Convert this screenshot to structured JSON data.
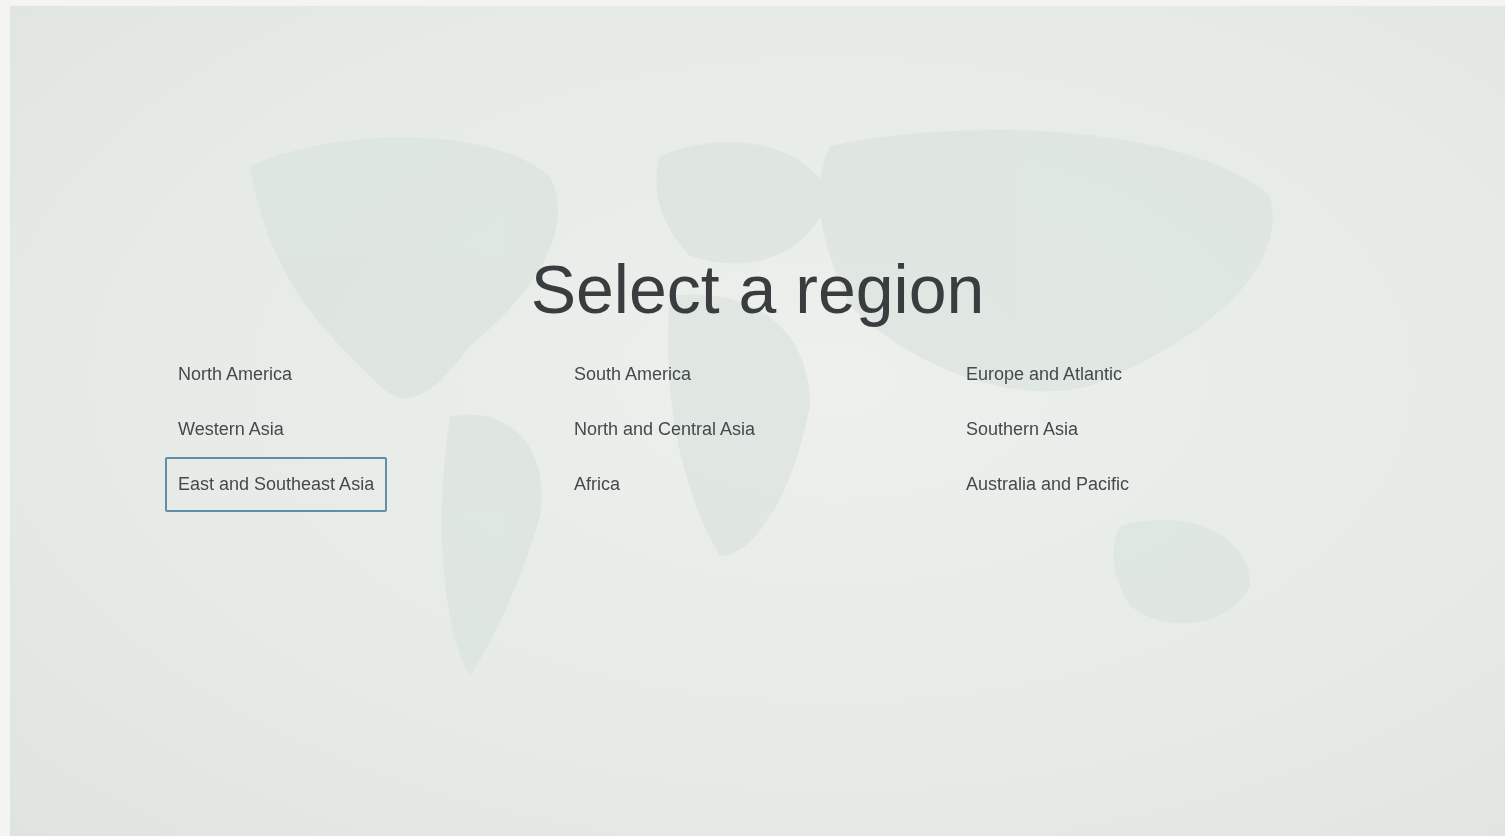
{
  "title": "Select a region",
  "regions": [
    {
      "label": "North America",
      "selected": false
    },
    {
      "label": "South America",
      "selected": false
    },
    {
      "label": "Europe and Atlantic",
      "selected": false
    },
    {
      "label": "Western Asia",
      "selected": false
    },
    {
      "label": "North and Central Asia",
      "selected": false
    },
    {
      "label": "Southern Asia",
      "selected": false
    },
    {
      "label": "East and Southeast Asia",
      "selected": true
    },
    {
      "label": "Africa",
      "selected": false
    },
    {
      "label": "Australia and Pacific",
      "selected": false
    }
  ]
}
